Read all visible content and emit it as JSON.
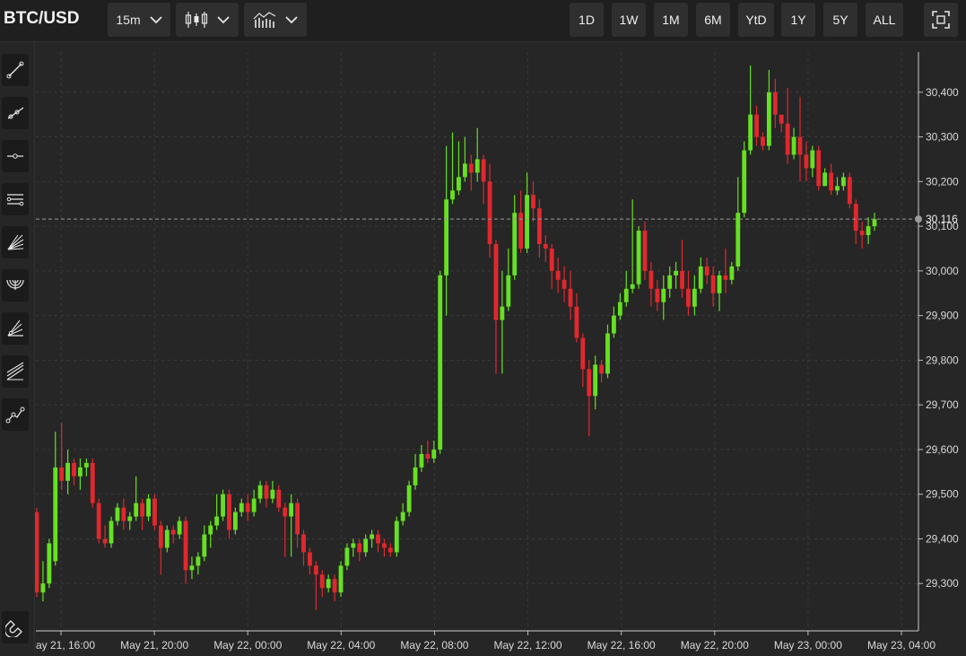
{
  "header": {
    "symbol": "BTC/USD",
    "interval": "15m",
    "candle_type_icon": "candlestick-icon",
    "indicator_icon": "indicators-icon",
    "fullscreen_icon": "fullscreen-icon"
  },
  "ranges": [
    "1D",
    "1W",
    "1M",
    "6M",
    "YtD",
    "1Y",
    "5Y",
    "ALL"
  ],
  "tools": [
    "trend-line-icon",
    "ray-line-icon",
    "horizontal-line-icon",
    "parallel-channel-icon",
    "fan-icon",
    "arc-icon",
    "pitchfork-icon",
    "regression-icon",
    "path-icon",
    "magnet-icon"
  ],
  "colors": {
    "up": "#66e022",
    "down": "#e0282e",
    "background": "#262626",
    "grid": "#3a3a3a"
  },
  "chart_data": {
    "type": "candlestick",
    "title": "",
    "current_price": "30,116",
    "ylim": [
      29200,
      30490
    ],
    "y_ticks": [
      "29,300",
      "29,400",
      "29,500",
      "29,600",
      "29,700",
      "29,800",
      "29,900",
      "30,000",
      "30,100",
      "30,200",
      "30,300",
      "30,400"
    ],
    "y_tick_values": [
      29300,
      29400,
      29500,
      29600,
      29700,
      29800,
      29900,
      30000,
      30100,
      30200,
      30300,
      30400
    ],
    "x_ticks": [
      "May 21, 16:00",
      "May 21, 20:00",
      "May 22, 00:00",
      "May 22, 04:00",
      "May 22, 08:00",
      "May 22, 12:00",
      "May 22, 16:00",
      "May 22, 20:00",
      "May 23, 00:00",
      "May 23, 04:00"
    ],
    "x_tick_hours": [
      0,
      4,
      8,
      12,
      16,
      20,
      24,
      28,
      32,
      36
    ],
    "x_start_hour": -1,
    "x_end_hour": 37,
    "candles": [
      [
        29460,
        29280,
        29470,
        29270
      ],
      [
        29280,
        29300,
        29350,
        29260
      ],
      [
        29300,
        29390,
        29400,
        29290
      ],
      [
        29350,
        29560,
        29640,
        29340
      ],
      [
        29560,
        29530,
        29660,
        29510
      ],
      [
        29530,
        29570,
        29600,
        29500
      ],
      [
        29570,
        29540,
        29580,
        29520
      ],
      [
        29540,
        29560,
        29580,
        29510
      ],
      [
        29560,
        29570,
        29580,
        29540
      ],
      [
        29570,
        29480,
        29580,
        29470
      ],
      [
        29480,
        29400,
        29490,
        29390
      ],
      [
        29400,
        29390,
        29430,
        29380
      ],
      [
        29390,
        29440,
        29450,
        29380
      ],
      [
        29440,
        29470,
        29480,
        29430
      ],
      [
        29470,
        29440,
        29490,
        29420
      ],
      [
        29440,
        29450,
        29460,
        29420
      ],
      [
        29450,
        29480,
        29540,
        29440
      ],
      [
        29480,
        29450,
        29490,
        29420
      ],
      [
        29450,
        29490,
        29500,
        29440
      ],
      [
        29490,
        29430,
        29500,
        29420
      ],
      [
        29430,
        29380,
        29440,
        29320
      ],
      [
        29380,
        29420,
        29430,
        29370
      ],
      [
        29420,
        29410,
        29430,
        29390
      ],
      [
        29410,
        29440,
        29450,
        29400
      ],
      [
        29440,
        29330,
        29450,
        29300
      ],
      [
        29330,
        29340,
        29360,
        29310
      ],
      [
        29340,
        29360,
        29370,
        29320
      ],
      [
        29360,
        29410,
        29430,
        29350
      ],
      [
        29410,
        29430,
        29440,
        29380
      ],
      [
        29430,
        29450,
        29500,
        29420
      ],
      [
        29450,
        29500,
        29510,
        29440
      ],
      [
        29500,
        29420,
        29510,
        29400
      ],
      [
        29420,
        29460,
        29470,
        29410
      ],
      [
        29460,
        29480,
        29490,
        29450
      ],
      [
        29480,
        29460,
        29500,
        29440
      ],
      [
        29460,
        29490,
        29510,
        29450
      ],
      [
        29490,
        29520,
        29530,
        29480
      ],
      [
        29520,
        29490,
        29530,
        29470
      ],
      [
        29490,
        29510,
        29530,
        29480
      ],
      [
        29510,
        29470,
        29520,
        29460
      ],
      [
        29470,
        29450,
        29480,
        29360
      ],
      [
        29450,
        29480,
        29500,
        29360
      ],
      [
        29480,
        29410,
        29490,
        29380
      ],
      [
        29410,
        29370,
        29420,
        29340
      ],
      [
        29370,
        29340,
        29380,
        29320
      ],
      [
        29340,
        29320,
        29350,
        29240
      ],
      [
        29320,
        29290,
        29330,
        29270
      ],
      [
        29290,
        29310,
        29320,
        29280
      ],
      [
        29310,
        29280,
        29320,
        29260
      ],
      [
        29280,
        29340,
        29350,
        29270
      ],
      [
        29340,
        29380,
        29390,
        29330
      ],
      [
        29380,
        29390,
        29400,
        29360
      ],
      [
        29390,
        29370,
        29400,
        29350
      ],
      [
        29370,
        29400,
        29410,
        29360
      ],
      [
        29400,
        29410,
        29420,
        29380
      ],
      [
        29410,
        29390,
        29420,
        29370
      ],
      [
        29390,
        29380,
        29400,
        29360
      ],
      [
        29380,
        29370,
        29390,
        29360
      ],
      [
        29370,
        29440,
        29450,
        29360
      ],
      [
        29440,
        29460,
        29480,
        29430
      ],
      [
        29460,
        29520,
        29530,
        29450
      ],
      [
        29520,
        29560,
        29590,
        29510
      ],
      [
        29560,
        29590,
        29610,
        29550
      ],
      [
        29590,
        29580,
        29620,
        29570
      ],
      [
        29580,
        29600,
        29620,
        29570
      ],
      [
        29600,
        29990,
        30000,
        29590
      ],
      [
        29990,
        30160,
        30280,
        29900
      ],
      [
        30160,
        30180,
        30310,
        30150
      ],
      [
        30180,
        30210,
        30290,
        30170
      ],
      [
        30210,
        30240,
        30300,
        30200
      ],
      [
        30240,
        30220,
        30260,
        30180
      ],
      [
        30220,
        30250,
        30320,
        30200
      ],
      [
        30250,
        30200,
        30260,
        30150
      ],
      [
        30200,
        30060,
        30240,
        30030
      ],
      [
        30060,
        29890,
        30070,
        29770
      ],
      [
        29890,
        29920,
        30000,
        29770
      ],
      [
        29920,
        29990,
        30050,
        29910
      ],
      [
        29990,
        30130,
        30170,
        29980
      ],
      [
        30130,
        30050,
        30180,
        30040
      ],
      [
        30050,
        30170,
        30220,
        30040
      ],
      [
        30170,
        30140,
        30200,
        30110
      ],
      [
        30140,
        30060,
        30160,
        30030
      ],
      [
        30060,
        30050,
        30080,
        30020
      ],
      [
        30050,
        30000,
        30060,
        29960
      ],
      [
        30000,
        29980,
        30030,
        29950
      ],
      [
        29980,
        29960,
        30010,
        29930
      ],
      [
        29960,
        29920,
        30000,
        29890
      ],
      [
        29920,
        29850,
        29950,
        29840
      ],
      [
        29850,
        29780,
        29860,
        29740
      ],
      [
        29780,
        29720,
        29800,
        29630
      ],
      [
        29720,
        29790,
        29810,
        29690
      ],
      [
        29790,
        29770,
        29800,
        29750
      ],
      [
        29770,
        29860,
        29880,
        29760
      ],
      [
        29860,
        29900,
        29920,
        29850
      ],
      [
        29900,
        29930,
        29950,
        29890
      ],
      [
        29930,
        29960,
        30000,
        29920
      ],
      [
        29960,
        29970,
        30160,
        29950
      ],
      [
        29970,
        30090,
        30100,
        29960
      ],
      [
        30090,
        30000,
        30110,
        29980
      ],
      [
        30000,
        29960,
        30020,
        29920
      ],
      [
        29960,
        29930,
        29980,
        29910
      ],
      [
        29930,
        29960,
        29990,
        29890
      ],
      [
        29960,
        29990,
        30010,
        29940
      ],
      [
        29990,
        30000,
        30020,
        29960
      ],
      [
        30000,
        29960,
        30070,
        29940
      ],
      [
        29960,
        29920,
        30000,
        29900
      ],
      [
        29920,
        29960,
        29990,
        29900
      ],
      [
        29960,
        30010,
        30030,
        29950
      ],
      [
        30010,
        29990,
        30030,
        29970
      ],
      [
        29990,
        29950,
        30010,
        29920
      ],
      [
        29950,
        29990,
        30000,
        29910
      ],
      [
        29990,
        29980,
        30050,
        29950
      ],
      [
        29980,
        30010,
        30020,
        29970
      ],
      [
        30010,
        30130,
        30210,
        30000
      ],
      [
        30130,
        30270,
        30290,
        30120
      ],
      [
        30270,
        30350,
        30460,
        30260
      ],
      [
        30350,
        30300,
        30370,
        30280
      ],
      [
        30300,
        30280,
        30310,
        30270
      ],
      [
        30280,
        30400,
        30450,
        30270
      ],
      [
        30400,
        30350,
        30430,
        30320
      ],
      [
        30350,
        30330,
        30340,
        30310
      ],
      [
        30330,
        30260,
        30410,
        30240
      ],
      [
        30260,
        30300,
        30320,
        30250
      ],
      [
        30300,
        30260,
        30390,
        30200
      ],
      [
        30260,
        30230,
        30290,
        30200
      ],
      [
        30230,
        30270,
        30280,
        30210
      ],
      [
        30270,
        30190,
        30280,
        30180
      ],
      [
        30190,
        30220,
        30230,
        30190
      ],
      [
        30220,
        30180,
        30240,
        30170
      ],
      [
        30180,
        30190,
        30210,
        30170
      ],
      [
        30190,
        30210,
        30220,
        30180
      ],
      [
        30210,
        30150,
        30220,
        30140
      ],
      [
        30150,
        30090,
        30160,
        30060
      ],
      [
        30090,
        30080,
        30110,
        30050
      ],
      [
        30080,
        30100,
        30120,
        30060
      ],
      [
        30100,
        30116,
        30130,
        30090
      ]
    ]
  }
}
